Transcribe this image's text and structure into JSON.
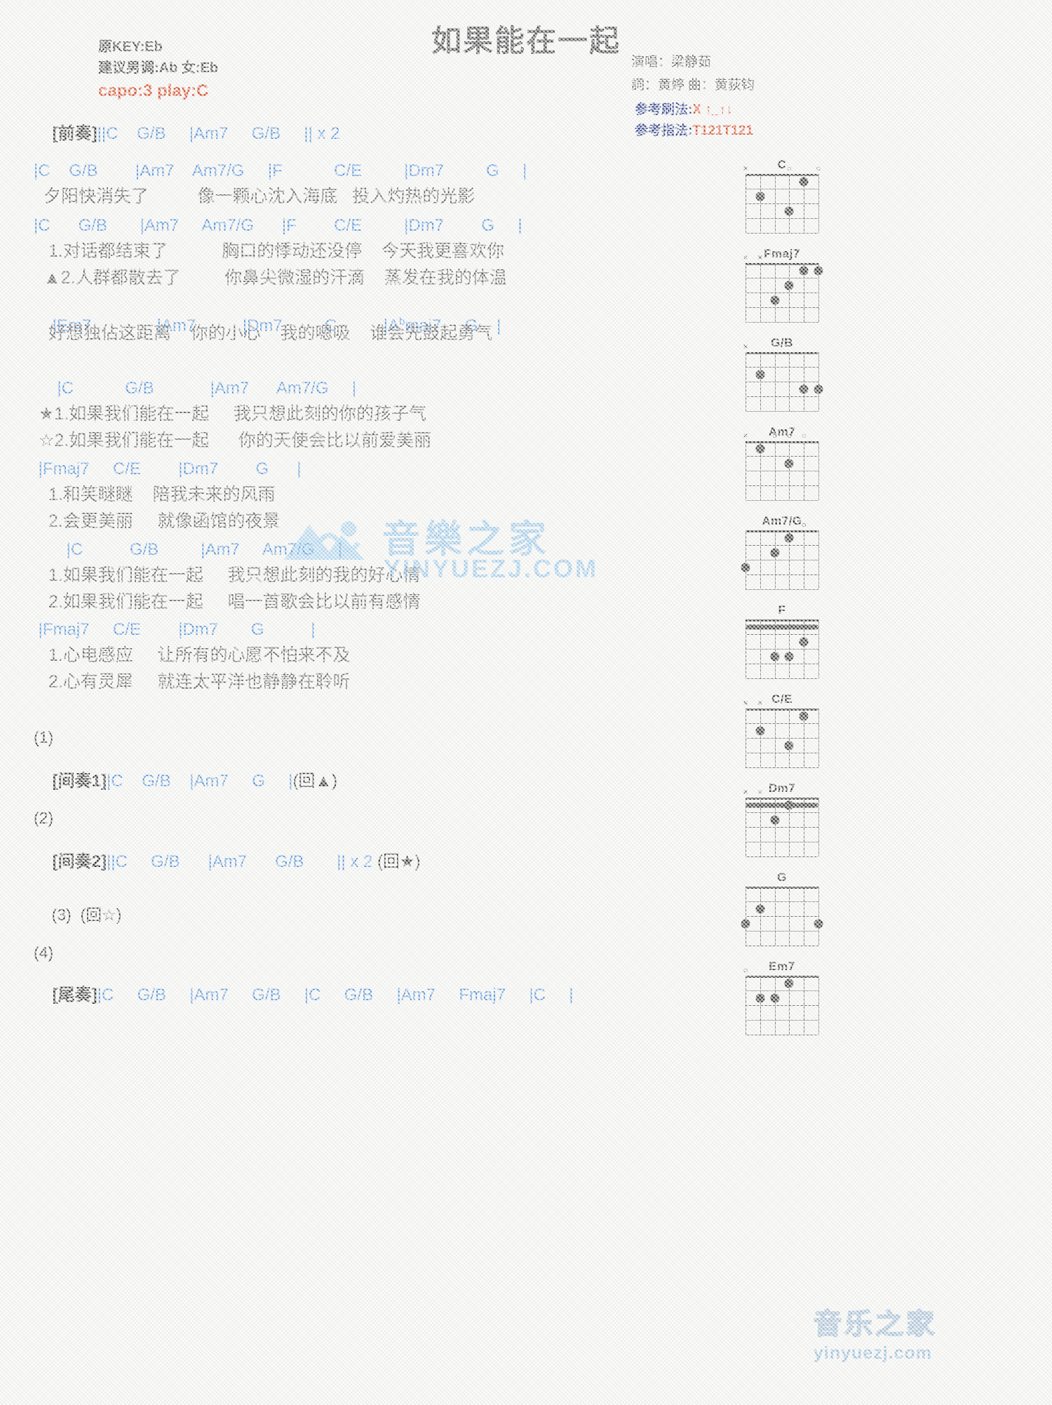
{
  "header": {
    "title": "如果能在一起",
    "orig_key": "原KEY:Eb",
    "suggest_key": "建议男调:Ab 女:Eb",
    "capo": "capo:3 play:C",
    "singer": "演唱：梁静茹",
    "writers": "詞：黄婷   曲：黄荻钧",
    "strum_label": "参考刷法:",
    "strum_value": "X ↑_↑↓",
    "finger_label": "参考指法:",
    "finger_value": "T121T121"
  },
  "sections": {
    "intro_label": "[前奏]",
    "intro_chords": "||C    G/B     |Am7     G/B     || x 2",
    "v1_chords_a": "|C    G/B        |Am7    Am7/G     |F           C/E         |Dm7         G     |",
    "v1_lyric_a": "夕阳快消失了          像一颗心沈入海底   投入灼热的光影",
    "v1_chords_b": "|C      G/B       |Am7     Am7/G      |F        C/E         |Dm7        G     |",
    "v1_lyric_b1": " 1.对话都结束了           胸口的悸动还没停    今天我更喜欢你",
    "v1_lyric_b2": "▲2.人群都散去了         你鼻尖微湿的汗滴    蒸发在我的体温",
    "v1_chords_c": "|Em7              |Am7          |Dm7         C          |A",
    "v1_chords_c_sup": "b",
    "v1_chords_c_tail": "maj7     G    |",
    "v1_lyric_c": " 好想独佔这距离    你的小心    我的嗯吸    谁会先鼓起勇气",
    "ch_chords_a": "     |C           G/B            |Am7      Am7/G     |",
    "ch_lyric_a1": "★1.如果我们能在一起     我只想此刻的你的孩子气",
    "ch_lyric_a2": "☆2.如果我们能在一起      你的天使会比以前爱美丽",
    "ch_chords_b": " |Fmaj7     C/E        |Dm7        G      |",
    "ch_lyric_b1": " 1.和笑瞇瞇    陪我未来的风雨",
    "ch_lyric_b2": " 2.会更美丽     就像函馆的夜景",
    "ch_chords_c": "       |C          G/B         |Am7     Am7/G     |",
    "ch_lyric_c1": " 1.如果我们能在一起     我只想此刻的我的好心情",
    "ch_lyric_c2": " 2.如果我们能在一起     唱一首歌会比以前有感情",
    "ch_chords_d": " |Fmaj7     C/E        |Dm7       G          |",
    "ch_lyric_d1": " 1.心电感应     让所有的心愿不怕来不及",
    "ch_lyric_d2": " 2.心有灵犀     就连太平洋也静静在聆听",
    "num1": "(1)",
    "inter1_label": "[间奏1]",
    "inter1_chords": "|C    G/B    |Am7     G     |",
    "inter1_repeat": "(回▲)",
    "num2": "(2)",
    "inter2_label": "[间奏2]",
    "inter2_chords": "||C     G/B      |Am7      G/B       || x 2 ",
    "inter2_repeat": "(回★)",
    "num3": "(3)",
    "num3_repeat": "(回☆)",
    "num4": "(4)",
    "outro_label": "[尾奏]",
    "outro_chords": "|C     G/B     |Am7     G/B     |C     G/B     |Am7     Fmaj7     |C     |"
  },
  "chord_diagrams": [
    {
      "name": "C",
      "markers": [
        "x",
        "",
        "",
        "o",
        "",
        "o"
      ],
      "dots": [
        [
          2,
          2
        ],
        [
          4,
          3
        ],
        [
          5,
          1
        ]
      ],
      "barre": null
    },
    {
      "name": "Fmaj7",
      "markers": [
        "x",
        "x",
        "",
        "",
        "",
        ""
      ],
      "dots": [
        [
          3,
          3
        ],
        [
          4,
          2
        ],
        [
          5,
          1
        ],
        [
          6,
          1
        ]
      ],
      "barre": null
    },
    {
      "name": "G/B",
      "markers": [
        "x",
        "",
        "",
        "",
        "",
        ""
      ],
      "dots": [
        [
          2,
          2
        ],
        [
          5,
          3
        ],
        [
          6,
          3
        ]
      ],
      "barre": null
    },
    {
      "name": "Am7",
      "markers": [
        "x",
        "",
        "o",
        "o",
        "o",
        ""
      ],
      "dots": [
        [
          2,
          1
        ],
        [
          4,
          2
        ]
      ],
      "barre": null
    },
    {
      "name": "Am7/G",
      "markers": [
        "",
        "",
        "",
        "",
        "o",
        ""
      ],
      "dots": [
        [
          1,
          3
        ],
        [
          3,
          2
        ],
        [
          4,
          1
        ]
      ],
      "barre": null
    },
    {
      "name": "F",
      "markers": [
        "",
        "",
        "",
        "",
        "",
        ""
      ],
      "dots": [
        [
          3,
          3
        ],
        [
          4,
          3
        ],
        [
          5,
          2
        ]
      ],
      "barre": 1
    },
    {
      "name": "C/E",
      "markers": [
        "x",
        "x",
        "",
        "",
        "",
        ""
      ],
      "dots": [
        [
          2,
          2
        ],
        [
          4,
          3
        ],
        [
          5,
          1
        ]
      ],
      "barre": null
    },
    {
      "name": "Dm7",
      "markers": [
        "x",
        "x",
        "",
        "",
        "",
        ""
      ],
      "dots": [
        [
          3,
          2
        ],
        [
          4,
          1
        ]
      ],
      "barre": 1
    },
    {
      "name": "G",
      "markers": [
        "",
        "",
        "",
        "",
        "",
        ""
      ],
      "dots": [
        [
          1,
          3
        ],
        [
          2,
          2
        ],
        [
          6,
          3
        ]
      ],
      "barre": null
    },
    {
      "name": "Em7",
      "markers": [
        "o",
        "",
        "",
        "",
        "",
        ""
      ],
      "dots": [
        [
          2,
          2
        ],
        [
          3,
          2
        ],
        [
          4,
          1
        ]
      ],
      "barre": null
    }
  ],
  "watermark": {
    "center_text": "音樂之家",
    "center_sub": "YINYUEZJ.COM",
    "bottom_text": "音乐之家",
    "bottom_sub": "yinyuezj.com"
  }
}
